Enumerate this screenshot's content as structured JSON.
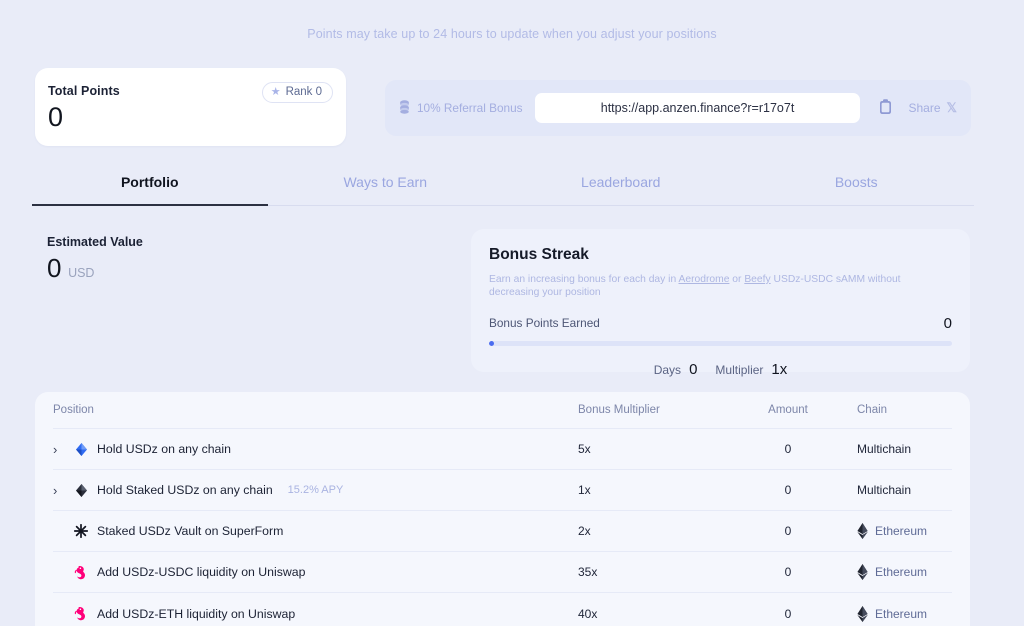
{
  "notice": "Points may take up to 24 hours to update when you adjust your positions",
  "total_points": {
    "label": "Total Points",
    "value": "0",
    "rank_label": "Rank 0",
    "star_icon": "star-icon"
  },
  "referral": {
    "label": "10% Referral Bonus",
    "icon": "coins-stack-icon",
    "url": "https://app.anzen.finance?r=r17o7t",
    "copy_icon": "clipboard-copy-icon",
    "share_label": "Share",
    "share_icon": "x-twitter-icon"
  },
  "tabs": [
    {
      "label": "Portfolio",
      "active": true
    },
    {
      "label": "Ways to Earn",
      "active": false
    },
    {
      "label": "Leaderboard",
      "active": false
    },
    {
      "label": "Boosts",
      "active": false
    }
  ],
  "estimated_value": {
    "label": "Estimated Value",
    "value": "0",
    "currency": "USD"
  },
  "bonus_streak": {
    "title": "Bonus Streak",
    "desc_pre": "Earn an increasing bonus for each day in ",
    "link1": "Aerodrome",
    "desc_mid": " or ",
    "link2": "Beefy",
    "desc_post": " USDz-USDC sAMM without decreasing your position",
    "points_label": "Bonus Points Earned",
    "points_value": "0",
    "progress_percent": 1,
    "days_label": "Days",
    "days_value": "0",
    "multiplier_label": "Multiplier",
    "multiplier_value": "1x"
  },
  "table": {
    "headers": {
      "position": "Position",
      "multiplier": "Bonus Multiplier",
      "amount": "Amount",
      "chain": "Chain"
    },
    "rows": [
      {
        "expandable": true,
        "icon": "usdz-token-icon",
        "name": "Hold USDz on any chain",
        "apy": "",
        "multiplier": "5x",
        "amount": "0",
        "chain": "Multichain",
        "chain_icon": ""
      },
      {
        "expandable": true,
        "icon": "staked-usdz-token-icon",
        "name": "Hold Staked USDz on any chain",
        "apy": "15.2% APY",
        "multiplier": "1x",
        "amount": "0",
        "chain": "Multichain",
        "chain_icon": ""
      },
      {
        "expandable": false,
        "icon": "superform-icon",
        "name": "Staked USDz Vault on SuperForm",
        "apy": "",
        "multiplier": "2x",
        "amount": "0",
        "chain": "Ethereum",
        "chain_icon": "ethereum-icon"
      },
      {
        "expandable": false,
        "icon": "uniswap-icon",
        "name": "Add USDz-USDC liquidity on Uniswap",
        "apy": "",
        "multiplier": "35x",
        "amount": "0",
        "chain": "Ethereum",
        "chain_icon": "ethereum-icon"
      },
      {
        "expandable": false,
        "icon": "uniswap-icon",
        "name": "Add USDz-ETH liquidity on Uniswap",
        "apy": "",
        "multiplier": "40x",
        "amount": "0",
        "chain": "Ethereum",
        "chain_icon": "ethereum-icon"
      }
    ]
  },
  "colors": {
    "background": "#e9ecf8",
    "accent": "#4a6cf0",
    "muted_text": "#a9b3e1",
    "uniswap_pink": "#ff007a"
  }
}
